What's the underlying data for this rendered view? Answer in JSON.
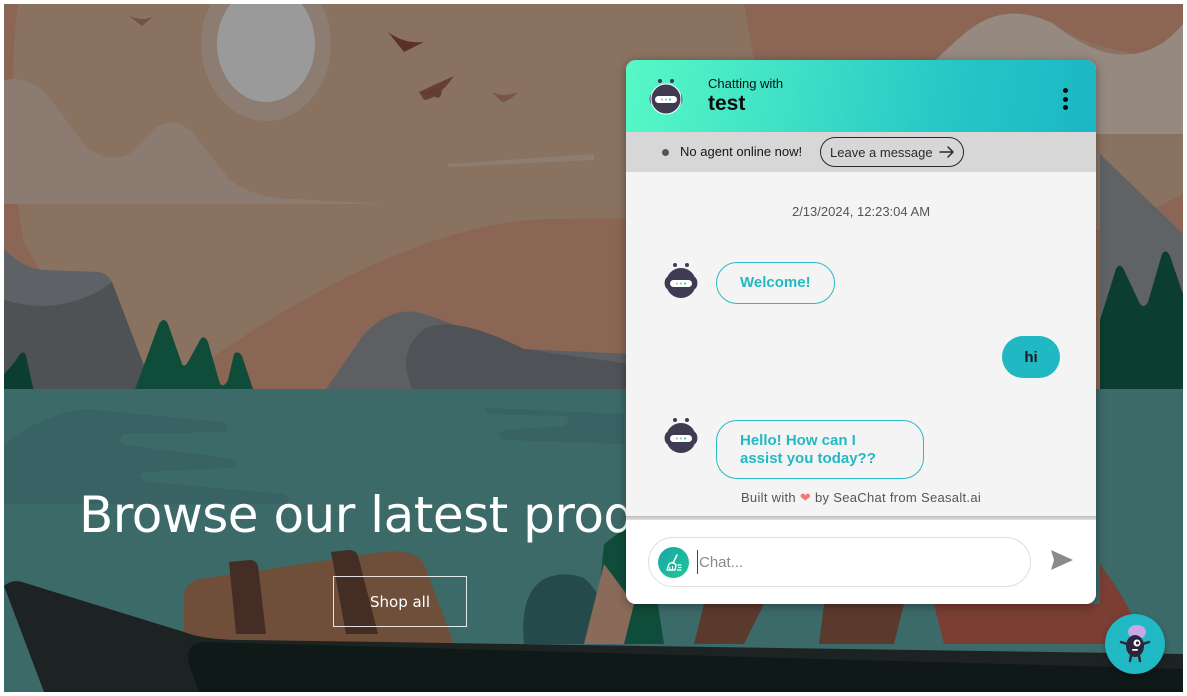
{
  "page": {
    "hero_title": "Browse our latest prod",
    "shop_all_label": "Shop all"
  },
  "chat": {
    "header": {
      "subtitle": "Chatting with",
      "name": "test",
      "avatar_icon": "robot-avatar-icon",
      "menu_icon": "more-vertical-icon"
    },
    "status": {
      "text": "No agent online now!",
      "leave_message_label": "Leave a message",
      "leave_message_icon": "arrow-right-icon"
    },
    "timestamp": "2/13/2024, 12:23:04 AM",
    "messages": [
      {
        "sender": "bot",
        "text": "Welcome!"
      },
      {
        "sender": "user",
        "text": "hi"
      },
      {
        "sender": "bot",
        "text": "Hello! How can I assist you today??"
      }
    ],
    "credit": {
      "prefix": "Built with",
      "heart": "❤",
      "suffix": "by SeaChat from Seasalt.ai"
    },
    "composer": {
      "placeholder": "Chat...",
      "value": "",
      "clear_icon": "broom-icon",
      "send_icon": "send-icon"
    }
  },
  "launcher": {
    "icon": "mascot-icon"
  },
  "colors": {
    "accent": "#1fb8c3",
    "header_gradient_start": "#57f9c6",
    "header_gradient_end": "#1bb7c4",
    "status_bar": "#d7d7d7"
  }
}
